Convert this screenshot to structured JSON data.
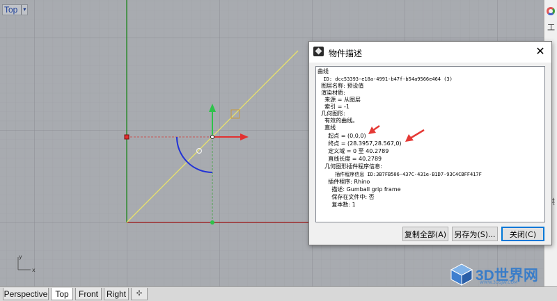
{
  "viewport": {
    "label": "Top",
    "caret_glyph": "▾",
    "axis_x_label": "x",
    "axis_y_label": "y"
  },
  "right_panel": {
    "icons": [
      "color-wheel-icon"
    ],
    "glyph_top": "工",
    "glyph_bottom": "洪"
  },
  "view_tabs": [
    {
      "label": "Perspective",
      "active": false
    },
    {
      "label": "Top",
      "active": true
    },
    {
      "label": "Front",
      "active": false
    },
    {
      "label": "Right",
      "active": false
    }
  ],
  "add_tab_glyph": "✣",
  "dialog": {
    "title": "物件描述",
    "close_glyph": "✕",
    "lines": [
      "曲线",
      "  ID: dcc53393-e18a-4991-b47f-b54a9566e464 (3)",
      "  图层名称: 预设值",
      "  渲染材质:",
      "    来源 = 从图层",
      "    索引 = -1",
      "  几何图形:",
      "    有效的曲线。",
      "    直线",
      "      起点 = (0,0,0)",
      "      终点 = (28.3957,28.567,0)",
      "      定义域 = 0 至 40.2789",
      "      直线长度 = 40.2789",
      "    几何图形插件程序信息:",
      "      插件程序信息 ID:3B7FB506-437C-431e-B1D7-93C4CBFF417F",
      "      插件程序: Rhino",
      "        描述: Gumball grip frame",
      "        保存在文件中: 否",
      "        复本数: 1"
    ],
    "buttons": {
      "copy_all": "复制全部(A)",
      "save_as": "另存为(S)...",
      "close": "关闭(C)"
    }
  },
  "watermark": {
    "text": "3D世界网",
    "url": "WWW.3DSJW.COM"
  },
  "colors": {
    "viewport_bg": "#a8abb0",
    "grid_minor": "#9ea1a6",
    "grid_major": "#8e9196",
    "x_axis": "#9c2b2b",
    "y_axis": "#2f8a2f",
    "curve": "#e8e26a",
    "gumball_x": "#e23030",
    "gumball_y": "#2ec24a",
    "gumball_arc": "#2233d6",
    "annotation_arrow": "#e53935"
  }
}
